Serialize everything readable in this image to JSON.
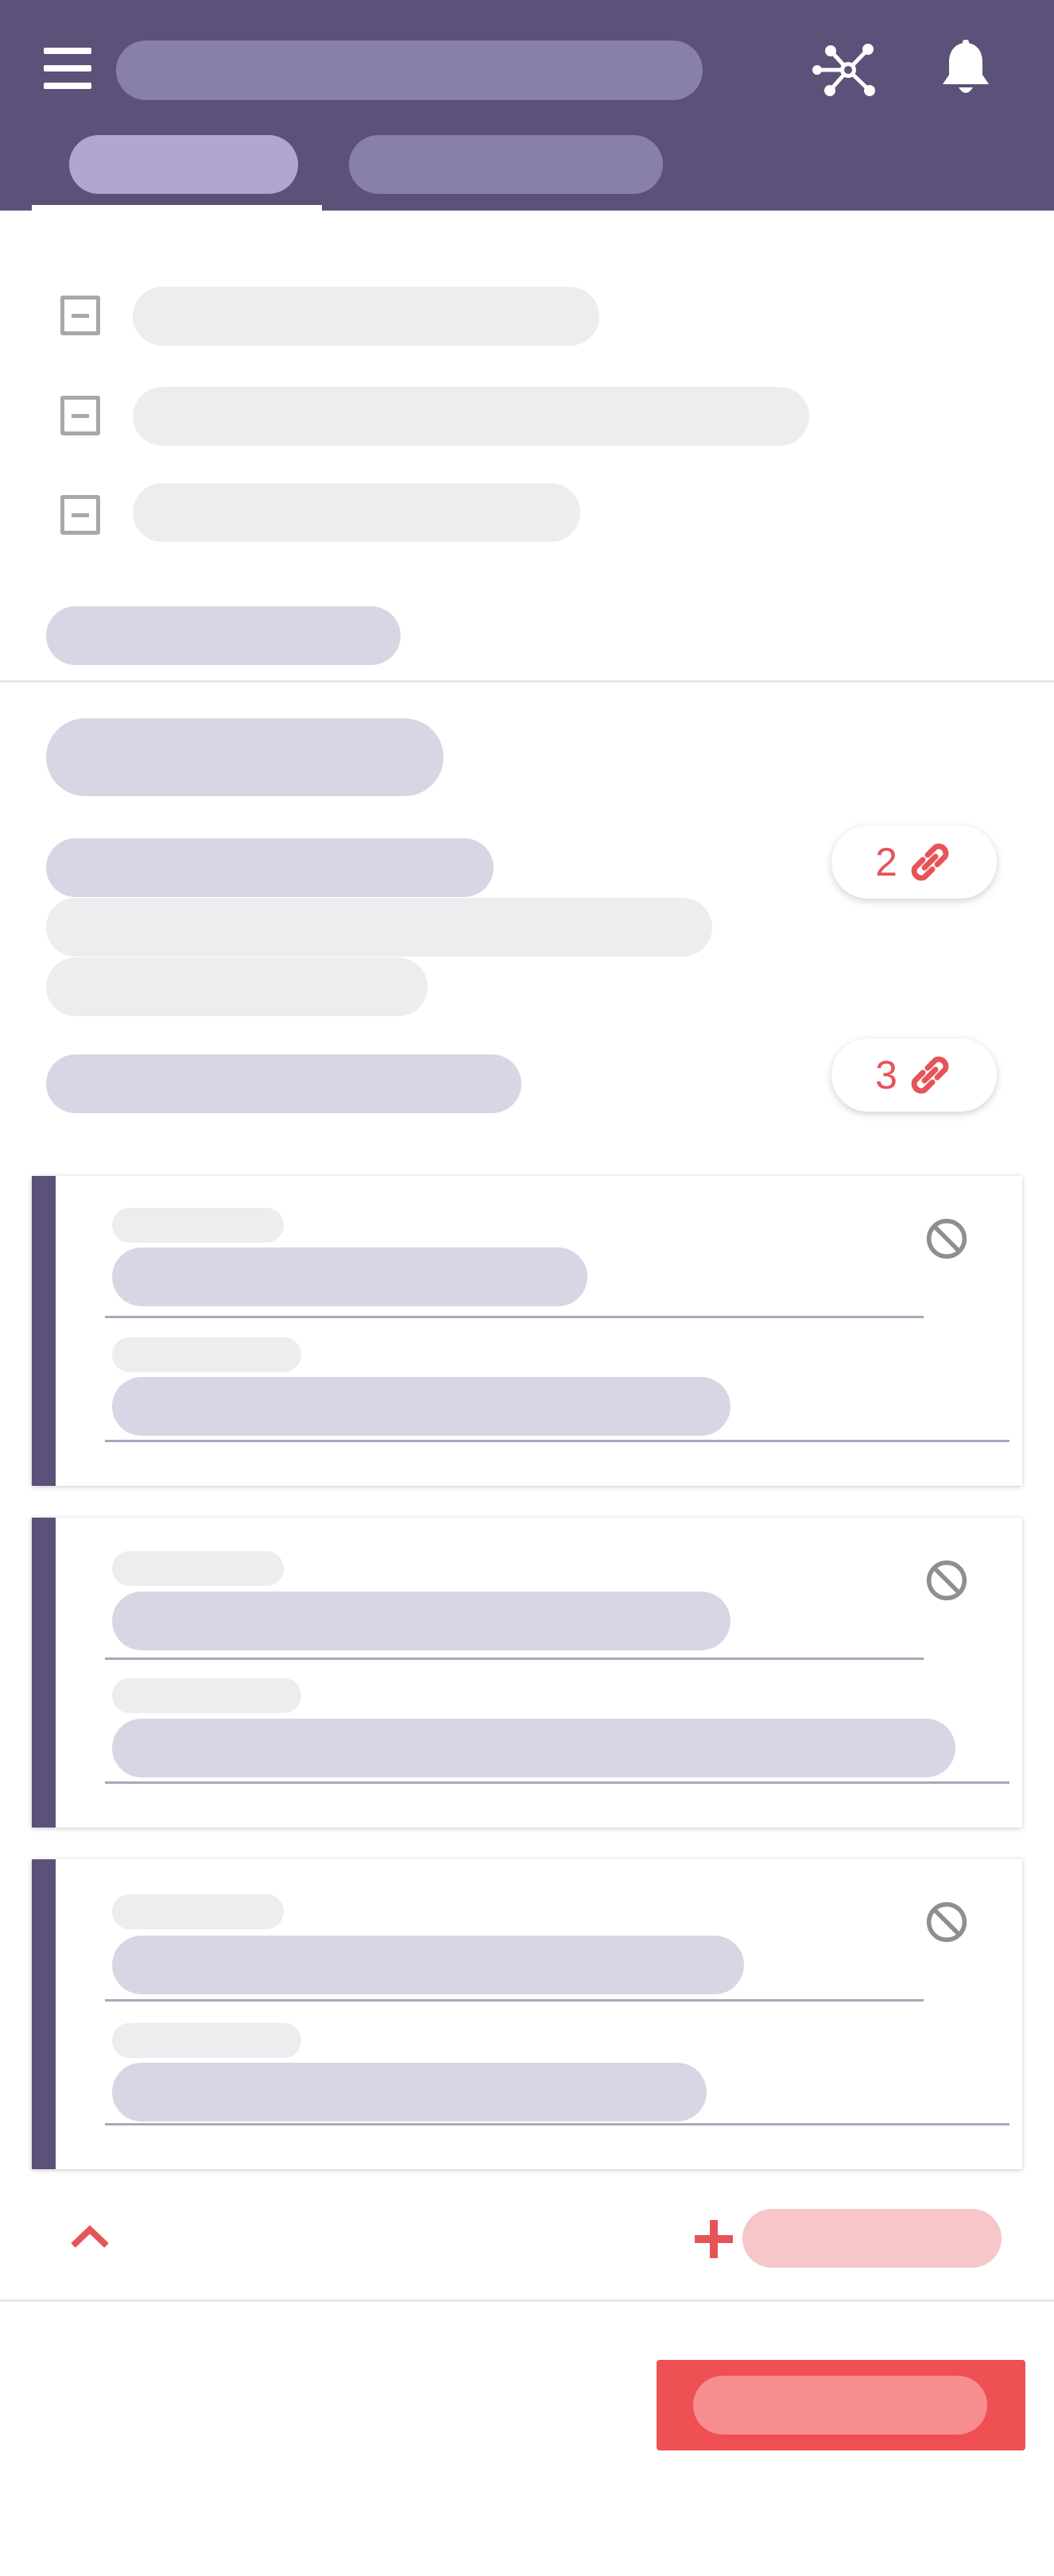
{
  "header": {
    "menu_icon": "hamburger-menu-icon",
    "network_icon": "network-graph-icon",
    "bell_icon": "notification-bell-icon",
    "title": "",
    "tabs": [
      {
        "label": "",
        "active": true
      },
      {
        "label": "",
        "active": false
      }
    ]
  },
  "checklist": {
    "items": [
      {
        "icon": "checkbox-indeterminate-icon",
        "label": ""
      },
      {
        "icon": "checkbox-indeterminate-icon",
        "label": ""
      },
      {
        "icon": "checkbox-indeterminate-icon",
        "label": ""
      }
    ],
    "footer_label": ""
  },
  "details": {
    "heading": "",
    "sections": [
      {
        "label": "",
        "link_count": "2",
        "link_icon": "link-icon"
      },
      {
        "label": "",
        "link_count": "3",
        "link_icon": "link-icon"
      }
    ]
  },
  "cards": [
    {
      "block_icon": "block-icon"
    },
    {
      "block_icon": "block-icon"
    },
    {
      "block_icon": "block-icon"
    }
  ],
  "actions": {
    "collapse_icon": "chevron-up-icon",
    "add_icon": "plus-icon",
    "add_label": "",
    "primary_label": ""
  },
  "colors": {
    "header_bg": "#5c5178",
    "accent": "#5c5178",
    "danger": "#ef5054",
    "link_badge_text": "#e65459"
  }
}
